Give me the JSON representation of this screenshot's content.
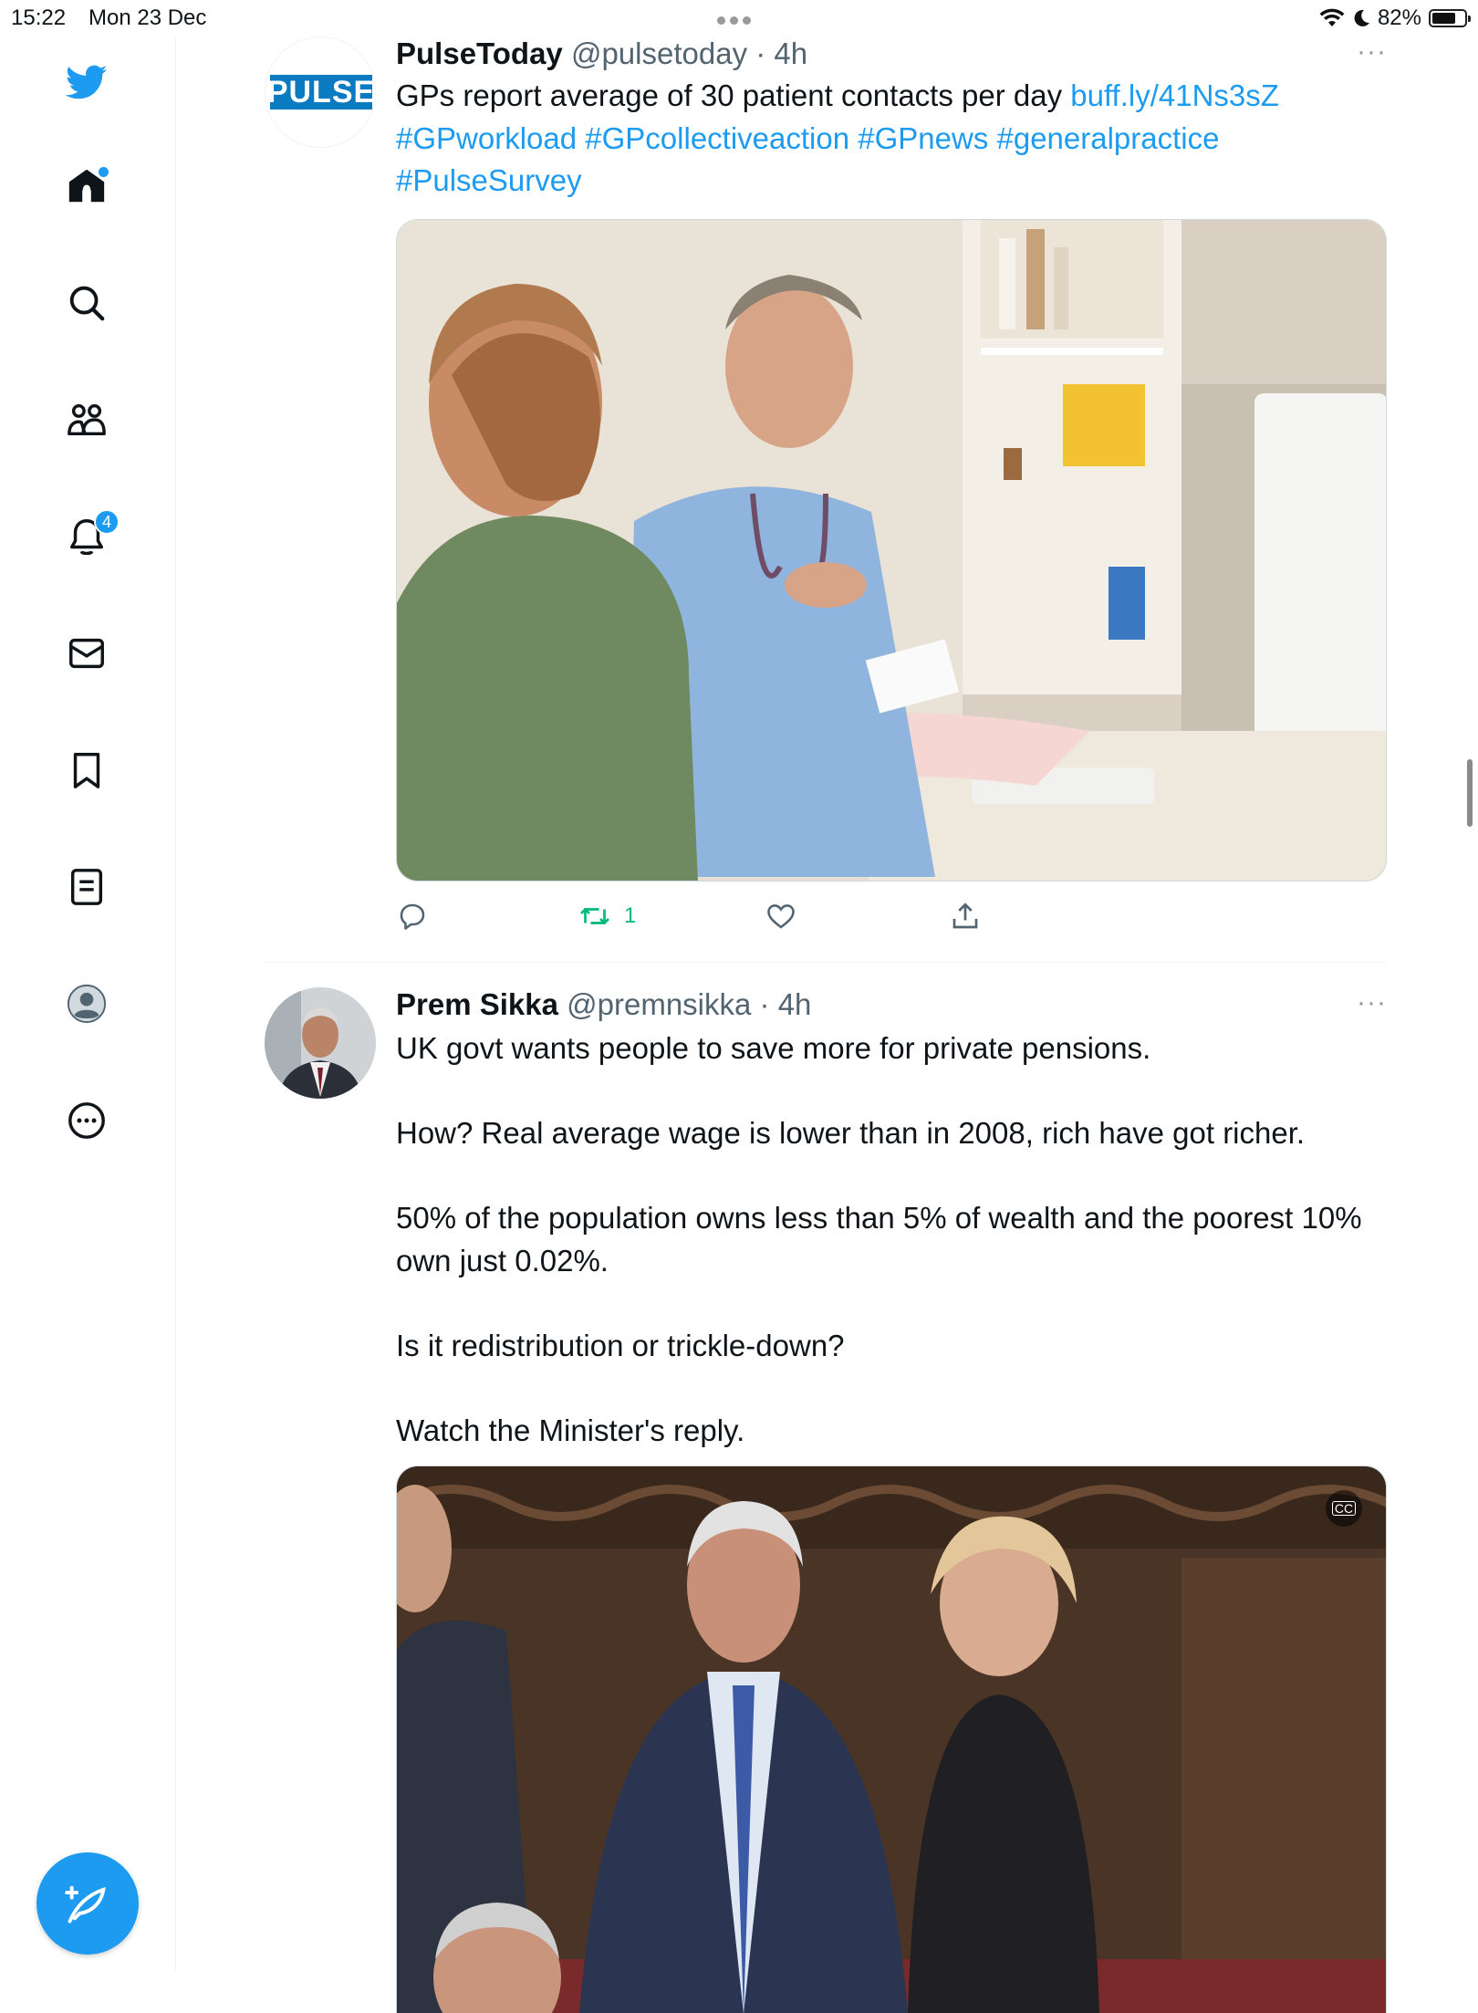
{
  "status_bar": {
    "time": "15:22",
    "date": "Mon 23 Dec",
    "battery": "82%",
    "battery_level": 0.82
  },
  "sidebar": {
    "items": [
      {
        "name": "twitter-logo-icon"
      },
      {
        "name": "home-icon",
        "has_dot": true
      },
      {
        "name": "search-icon"
      },
      {
        "name": "communities-icon"
      },
      {
        "name": "notifications-icon",
        "badge": "4"
      },
      {
        "name": "messages-icon"
      },
      {
        "name": "bookmarks-icon"
      },
      {
        "name": "lists-icon"
      },
      {
        "name": "profile-icon"
      },
      {
        "name": "more-icon"
      }
    ],
    "compose_icon": "compose-feather-icon"
  },
  "tweets": [
    {
      "name": "PulseToday",
      "handle": "@pulsetoday",
      "time": "4h",
      "avatar_label": "PULSE",
      "text": "GPs report average of 30 patient contacts per day ",
      "link": "buff.ly/41Ns3sZ",
      "hashtags": "#GPworkload #GPcollectiveaction #GPnews #generalpractice #PulseSurvey",
      "retweets": "1",
      "media": "photo-gp-consultation"
    },
    {
      "name": "Prem Sikka",
      "handle": "@premnsikka",
      "time": "4h",
      "paragraphs": [
        "UK govt wants people to save more for private pensions.",
        "How? Real average wage is lower than in 2008, rich have got richer.",
        "50% of the population owns less than 5% of wealth and the poorest 10% own just 0.02%.",
        "Is it redistribution or trickle-down?",
        "Watch the Minister's reply."
      ],
      "media": "video-house-of-lords",
      "cc_label": "CC"
    }
  ],
  "colors": {
    "accent": "#1d9bf0",
    "text": "#0f1419",
    "muted": "#536471",
    "retweet_green": "#00ba7c"
  }
}
